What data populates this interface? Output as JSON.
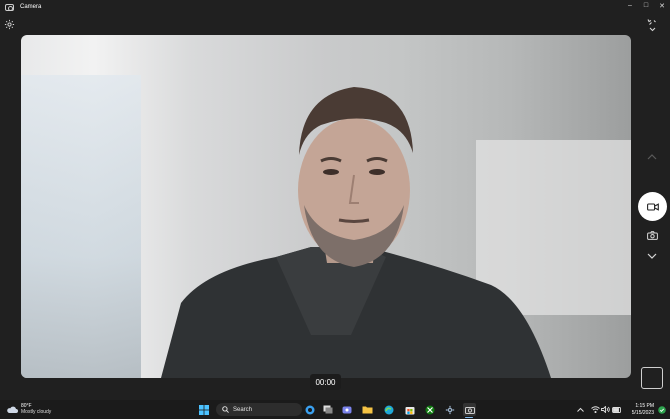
{
  "window": {
    "title": "Camera",
    "controls": {
      "minimize": "–",
      "maximize": "□",
      "close": "✕"
    }
  },
  "camera": {
    "timer": "00:00",
    "icons": {
      "settings": "gear-icon",
      "scene": "scene-toggle-icon",
      "mode_up": "chevron-up-icon",
      "record": "video-camera-icon",
      "photo": "camera-icon",
      "mode_down": "chevron-down-icon"
    },
    "accent": "#ffffff"
  },
  "taskbar": {
    "weather": {
      "temp": "80°F",
      "condition": "Mostly cloudy"
    },
    "search_label": "Search",
    "apps": [
      "start",
      "search",
      "copilot",
      "task-view",
      "teams",
      "file-explorer",
      "edge",
      "store",
      "xbox",
      "settings",
      "camera"
    ],
    "clock": {
      "time": "1:15 PM",
      "date": "5/15/2023"
    },
    "accent": "#7fb7e8"
  }
}
